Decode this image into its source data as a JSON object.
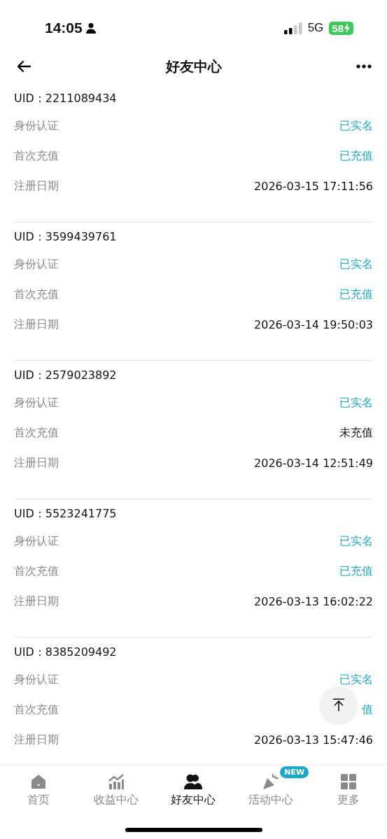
{
  "status_bar": {
    "time": "14:05",
    "network": "5G",
    "battery": "58"
  },
  "header": {
    "title": "好友中心"
  },
  "friends": [
    {
      "uid_label": "UID：",
      "uid": "2211089434",
      "rows": [
        {
          "label": "身份认证",
          "value": "已实名",
          "highlighted": true
        },
        {
          "label": "首次充值",
          "value": "已充值",
          "highlighted": true
        },
        {
          "label": "注册日期",
          "value": "2026-03-15 17:11:56",
          "highlighted": false
        }
      ]
    },
    {
      "uid_label": "UID：",
      "uid": "3599439761",
      "rows": [
        {
          "label": "身份认证",
          "value": "已实名",
          "highlighted": true
        },
        {
          "label": "首次充值",
          "value": "已充值",
          "highlighted": true
        },
        {
          "label": "注册日期",
          "value": "2026-03-14 19:50:03",
          "highlighted": false
        }
      ]
    },
    {
      "uid_label": "UID：",
      "uid": "2579023892",
      "rows": [
        {
          "label": "身份认证",
          "value": "已实名",
          "highlighted": true
        },
        {
          "label": "首次充值",
          "value": "未充值",
          "highlighted": false
        },
        {
          "label": "注册日期",
          "value": "2026-03-14 12:51:49",
          "highlighted": false
        }
      ]
    },
    {
      "uid_label": "UID：",
      "uid": "5523241775",
      "rows": [
        {
          "label": "身份认证",
          "value": "已实名",
          "highlighted": true
        },
        {
          "label": "首次充值",
          "value": "已充值",
          "highlighted": true
        },
        {
          "label": "注册日期",
          "value": "2026-03-13 16:02:22",
          "highlighted": false
        }
      ]
    },
    {
      "uid_label": "UID：",
      "uid": "8385209492",
      "rows": [
        {
          "label": "身份认证",
          "value": "已实名",
          "highlighted": true
        },
        {
          "label": "首次充值",
          "value": "值",
          "highlighted": true
        },
        {
          "label": "注册日期",
          "value": "2026-03-13 15:47:46",
          "highlighted": false
        }
      ]
    }
  ],
  "tabs": [
    {
      "label": "首页",
      "kind": "home",
      "selected": false
    },
    {
      "label": "收益中心",
      "kind": "chart",
      "selected": false
    },
    {
      "label": "好友中心",
      "kind": "friends",
      "selected": true
    },
    {
      "label": "活动中心",
      "kind": "party",
      "selected": false,
      "badge": "NEW"
    },
    {
      "label": "更多",
      "kind": "grid",
      "selected": false
    }
  ]
}
